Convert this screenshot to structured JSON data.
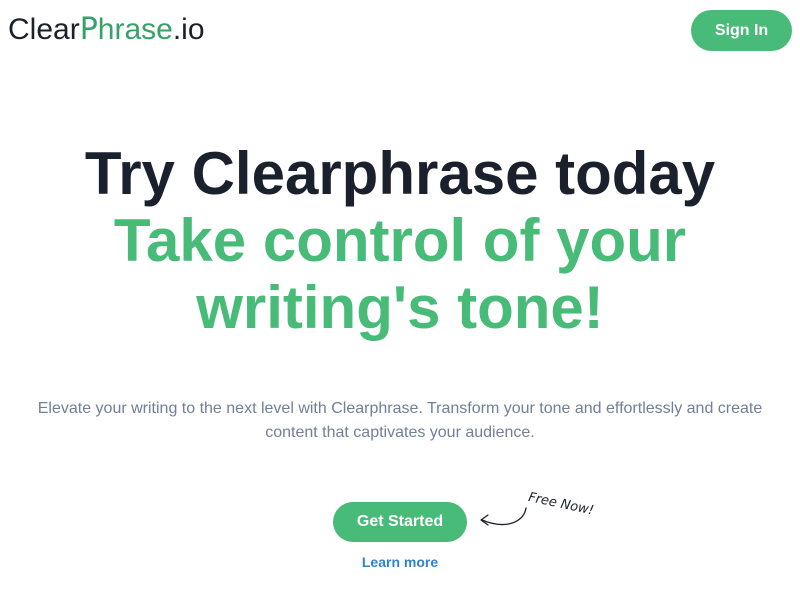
{
  "header": {
    "logo_prefix": "Clear",
    "logo_accent_letter": "P",
    "logo_accent_rest": "hrase",
    "logo_suffix": ".io",
    "signin_label": "Sign In"
  },
  "hero": {
    "title_line1": "Try Clearphrase today",
    "title_line2": "Take control of your writing's tone!",
    "description": "Elevate your writing to the next level with Clearphrase. Transform your tone and effortlessly and create content that captivates your audience.",
    "cta_label": "Get Started",
    "secondary_link": "Learn more",
    "callout": "Free Now!"
  },
  "colors": {
    "brand_green": "#48bb78",
    "dark_text": "#1a202c",
    "muted_text": "#718096",
    "link_blue": "#3182ce"
  },
  "icons": {
    "callout_arrow": "curved-arrow-icon"
  }
}
